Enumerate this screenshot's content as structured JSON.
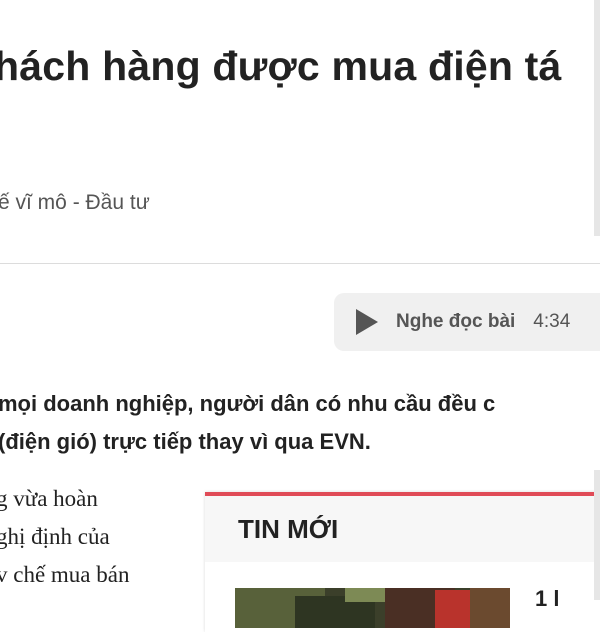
{
  "article": {
    "title": "hách hàng được mua điện tá",
    "category": "ế vĩ mô - Đầu tư",
    "lead_lines": [
      "mọi doanh nghiệp, người dân có nhu cầu đều c",
      "(điện gió) trực tiếp thay vì qua EVN."
    ],
    "body_lines": [
      "g vừa hoàn",
      "ghị định của",
      "v chế mua bán"
    ]
  },
  "audio": {
    "label": "Nghe đọc bài",
    "duration": "4:34",
    "icon": "play-icon"
  },
  "news_box": {
    "header": "TIN MỚI",
    "first_item_title": "1 l",
    "accent_color": "#e04b57"
  }
}
